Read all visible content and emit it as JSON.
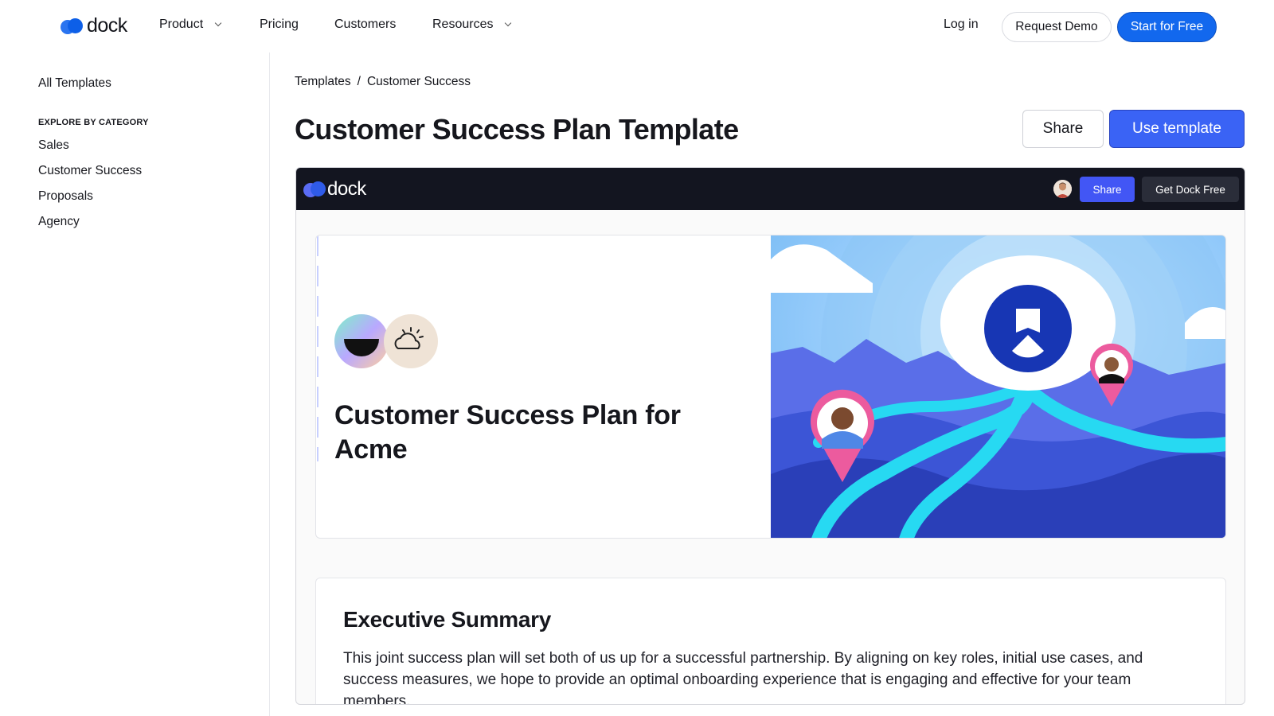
{
  "nav": {
    "logo_text": "dock",
    "product": "Product",
    "pricing": "Pricing",
    "customers": "Customers",
    "resources": "Resources",
    "login": "Log in",
    "request_demo": "Request Demo",
    "start_free": "Start for Free",
    "brand_color": "#1268ee"
  },
  "sidebar": {
    "all_templates": "All Templates",
    "category_heading": "EXPLORE BY CATEGORY",
    "categories": [
      "Sales",
      "Customer Success",
      "Proposals",
      "Agency"
    ]
  },
  "main": {
    "breadcrumb": [
      "Templates",
      "/",
      "Customer Success"
    ],
    "title": "Customer Success Plan Template",
    "share": "Share",
    "use_template": "Use template",
    "accent_color": "#3a63f5"
  },
  "preview": {
    "logo_text": "dock",
    "share": "Share",
    "get_dock_free": "Get Dock Free",
    "hero_title": "Customer Success Plan for Acme",
    "summary_title": "Executive Summary",
    "summary_text": "This joint success plan will set both of us up for a successful partnership. By aligning on key roles, initial use cases, and success measures, we hope to provide an optimal onboarding experience that is engaging and effective for your team members."
  },
  "icons": {
    "nav_chevron": "chevron-down-icon",
    "partner_logo_1": "half-circle-logo-icon",
    "partner_logo_2": "sun-cloud-logo-icon"
  }
}
